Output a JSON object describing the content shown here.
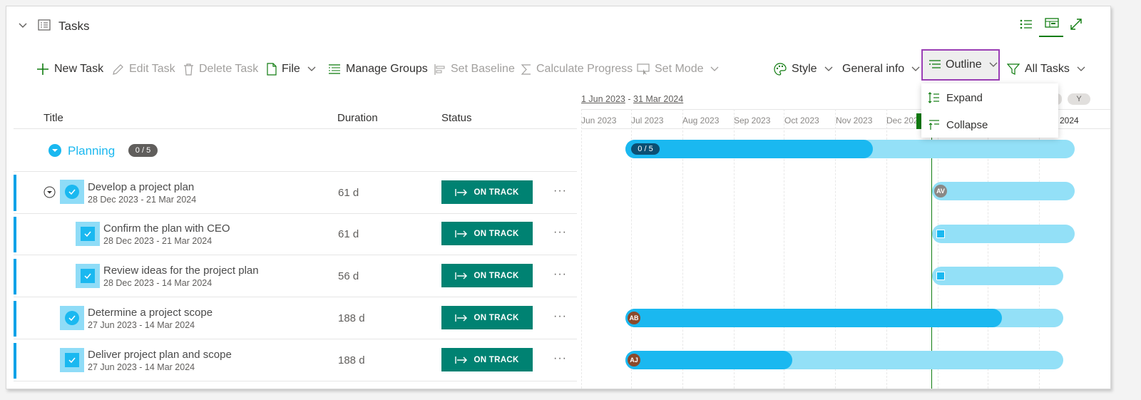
{
  "header": {
    "title": "Tasks"
  },
  "toolbar": {
    "new_task": "New Task",
    "edit_task": "Edit Task",
    "delete_task": "Delete Task",
    "file": "File",
    "manage_groups": "Manage Groups",
    "set_baseline": "Set Baseline",
    "calculate_progress": "Calculate Progress",
    "set_mode": "Set Mode",
    "style": "Style",
    "general_info": "General info",
    "outline": "Outline",
    "all_tasks": "All Tasks"
  },
  "outline_menu": {
    "items": [
      "Expand",
      "Collapse"
    ]
  },
  "columns": {
    "title": "Title",
    "duration": "Duration",
    "status": "Status"
  },
  "group": {
    "name": "Planning",
    "count": "0 / 5"
  },
  "tasks": [
    {
      "title": "Develop a project plan",
      "dates": "28 Dec 2023 - 21 Mar 2024",
      "duration": "61 d",
      "status": "ON TRACK",
      "avatar": "AV"
    },
    {
      "title": "Confirm the plan with CEO",
      "dates": "28 Dec 2023 - 21 Mar 2024",
      "duration": "61 d",
      "status": "ON TRACK",
      "avatar": ""
    },
    {
      "title": "Review ideas for the project plan",
      "dates": "28 Dec 2023 - 14 Mar 2024",
      "duration": "56 d",
      "status": "ON TRACK",
      "avatar": ""
    },
    {
      "title": "Determine a project scope",
      "dates": "27 Jun 2023 - 14 Mar 2024",
      "duration": "188 d",
      "status": "ON TRACK",
      "avatar": "AB"
    },
    {
      "title": "Deliver project plan and scope",
      "dates": "27 Jun 2023 - 14 Mar 2024",
      "duration": "188 d",
      "status": "ON TRACK",
      "avatar": "AJ"
    }
  ],
  "gantt": {
    "range_start": "1 Jun 2023",
    "range_end": "31 Mar 2024",
    "range_sep": "-",
    "months": [
      "Jun 2023",
      "Jul 2023",
      "Aug 2023",
      "Sep 2023",
      "Oct 2023",
      "Nov 2023",
      "Dec 2023",
      "2024"
    ],
    "scale_y": "Y",
    "group_progress": "0 / 5"
  },
  "colors": {
    "accent_green": "#107c10",
    "status_green": "#008272",
    "bar_light": "#93e0f7",
    "bar_dark": "#1ab8f0",
    "highlight": "#9b3fb5"
  },
  "icons": [
    "chevron-down-icon",
    "tasks-icon",
    "list-view-icon",
    "gantt-view-icon",
    "expand-icon",
    "plus-icon",
    "pencil-icon",
    "trash-icon",
    "file-icon",
    "manage-groups-icon",
    "baseline-icon",
    "sigma-icon",
    "set-mode-icon",
    "palette-icon",
    "outline-icon",
    "filter-icon"
  ]
}
